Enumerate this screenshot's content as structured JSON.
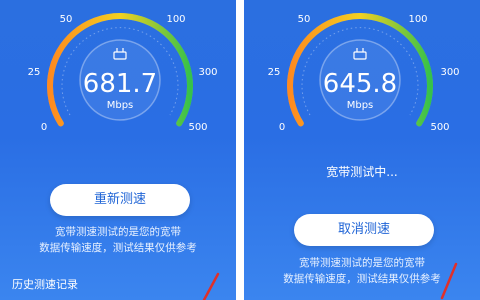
{
  "left": {
    "speed_value": "681.7",
    "speed_unit": "Mbps",
    "gauge_level_fraction": 0.96,
    "ticks": [
      "0",
      "25",
      "50",
      "100",
      "300",
      "500"
    ],
    "button_label": "重新测速",
    "desc_line1": "宽带测速测试的是您的宽带",
    "desc_line2": "数据传输速度，测试结果仅供参考",
    "history_label": "历史测速记录"
  },
  "right": {
    "speed_value": "645.8",
    "speed_unit": "Mbps",
    "gauge_level_fraction": 0.95,
    "ticks": [
      "0",
      "25",
      "50",
      "100",
      "300",
      "500"
    ],
    "status_text": "宽带测试中...",
    "button_label": "取消测速",
    "desc_line1": "宽带测速测试的是您的宽带",
    "desc_line2": "数据传输速度，测试结果仅供参考"
  },
  "colors": {
    "background": "#2b6fe0",
    "button_text": "#1f64d6",
    "gauge_start": "#ff8a1f",
    "gauge_mid": "#f3d020",
    "gauge_end": "#36c24a",
    "annotation": "#e0302a"
  },
  "icons": [
    "router-icon"
  ]
}
